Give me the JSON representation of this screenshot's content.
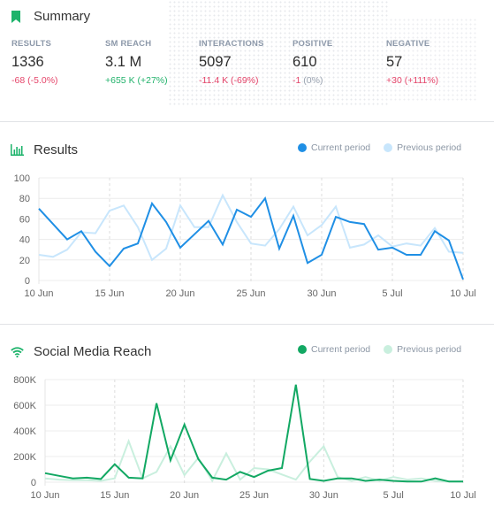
{
  "summary": {
    "title": "Summary",
    "icon": "bookmark-icon",
    "metrics": [
      {
        "label": "RESULTS",
        "value": "1336",
        "change": "-68",
        "change_pct": "(-5.0%)",
        "trend": "negative",
        "pct_trend": "negative"
      },
      {
        "label": "SM REACH",
        "value": "3.1 M",
        "change": "+655 K",
        "change_pct": "(+27%)",
        "trend": "positive",
        "pct_trend": "positive"
      },
      {
        "label": "INTERACTIONS",
        "value": "5097",
        "change": "-11.4 K",
        "change_pct": "(-69%)",
        "trend": "negative",
        "pct_trend": "negative"
      },
      {
        "label": "POSITIVE",
        "value": "610",
        "change": "-1",
        "change_pct": "(0%)",
        "trend": "negative",
        "pct_trend": "neutral"
      },
      {
        "label": "NEGATIVE",
        "value": "57",
        "change": "+30",
        "change_pct": "(+111%)",
        "trend": "negative",
        "pct_trend": "negative"
      }
    ]
  },
  "results": {
    "title": "Results",
    "icon": "bar-chart-icon",
    "legend": {
      "current": "Current period",
      "previous": "Previous period"
    }
  },
  "reach": {
    "title": "Social Media Reach",
    "icon": "wifi-icon",
    "legend": {
      "current": "Current period",
      "previous": "Previous period"
    }
  },
  "colors": {
    "brand_green": "#1db36b",
    "results_current": "#1f8fe5",
    "results_previous": "#c8e6fc",
    "reach_current": "#12a863",
    "reach_previous": "#c9efde",
    "negative": "#e5456a",
    "positive": "#21b26b"
  },
  "chart_data": [
    {
      "type": "line",
      "title": "Results",
      "xlabel": "",
      "ylabel": "",
      "x_ticks": [
        "10 Jun",
        "15 Jun",
        "20 Jun",
        "25 Jun",
        "30 Jun",
        "5 Jul",
        "10 Jul"
      ],
      "y_ticks": [
        "0",
        "20",
        "40",
        "60",
        "80",
        "100"
      ],
      "ylim": [
        0,
        100
      ],
      "grid": true,
      "legend_position": "top-right",
      "x": [
        "10 Jun",
        "11 Jun",
        "12 Jun",
        "13 Jun",
        "14 Jun",
        "15 Jun",
        "16 Jun",
        "17 Jun",
        "18 Jun",
        "19 Jun",
        "20 Jun",
        "21 Jun",
        "22 Jun",
        "23 Jun",
        "24 Jun",
        "25 Jun",
        "26 Jun",
        "27 Jun",
        "28 Jun",
        "29 Jun",
        "30 Jun",
        "1 Jul",
        "2 Jul",
        "3 Jul",
        "4 Jul",
        "5 Jul",
        "6 Jul",
        "7 Jul",
        "8 Jul",
        "9 Jul",
        "10 Jul"
      ],
      "series": [
        {
          "name": "Current period",
          "values": [
            70,
            55,
            40,
            48,
            28,
            14,
            31,
            36,
            75,
            57,
            32,
            45,
            58,
            35,
            69,
            62,
            80,
            31,
            63,
            17,
            25,
            62,
            57,
            55,
            30,
            32,
            25,
            25,
            48,
            39,
            1
          ]
        },
        {
          "name": "Previous period",
          "values": [
            25,
            23,
            30,
            47,
            46,
            68,
            73,
            52,
            20,
            31,
            73,
            52,
            52,
            83,
            57,
            36,
            34,
            50,
            72,
            44,
            54,
            72,
            32,
            35,
            44,
            33,
            36,
            34,
            51,
            28,
            27
          ]
        }
      ]
    },
    {
      "type": "line",
      "title": "Social Media Reach",
      "xlabel": "",
      "ylabel": "",
      "x_ticks": [
        "10 Jun",
        "15 Jun",
        "20 Jun",
        "25 Jun",
        "30 Jun",
        "5 Jul",
        "10 Jul"
      ],
      "y_ticks": [
        "0",
        "200K",
        "400K",
        "600K",
        "800K"
      ],
      "ylim": [
        0,
        800000
      ],
      "grid": true,
      "legend_position": "top-right",
      "x": [
        "10 Jun",
        "11 Jun",
        "12 Jun",
        "13 Jun",
        "14 Jun",
        "15 Jun",
        "16 Jun",
        "17 Jun",
        "18 Jun",
        "19 Jun",
        "20 Jun",
        "21 Jun",
        "22 Jun",
        "23 Jun",
        "24 Jun",
        "25 Jun",
        "26 Jun",
        "27 Jun",
        "28 Jun",
        "29 Jun",
        "30 Jun",
        "1 Jul",
        "2 Jul",
        "3 Jul",
        "4 Jul",
        "5 Jul",
        "6 Jul",
        "7 Jul",
        "8 Jul",
        "9 Jul",
        "10 Jul"
      ],
      "series": [
        {
          "name": "Current period",
          "values": [
            70000,
            50000,
            30000,
            35000,
            25000,
            140000,
            35000,
            30000,
            615000,
            170000,
            450000,
            180000,
            35000,
            20000,
            80000,
            40000,
            90000,
            110000,
            760000,
            25000,
            10000,
            30000,
            30000,
            10000,
            20000,
            10000,
            5000,
            5000,
            30000,
            5000,
            5000
          ]
        },
        {
          "name": "Previous period",
          "values": [
            30000,
            20000,
            15000,
            15000,
            10000,
            30000,
            320000,
            30000,
            80000,
            280000,
            55000,
            190000,
            10000,
            225000,
            20000,
            110000,
            100000,
            60000,
            20000,
            160000,
            280000,
            40000,
            10000,
            40000,
            10000,
            40000,
            20000,
            30000,
            10000,
            5000,
            5000
          ]
        }
      ]
    }
  ]
}
